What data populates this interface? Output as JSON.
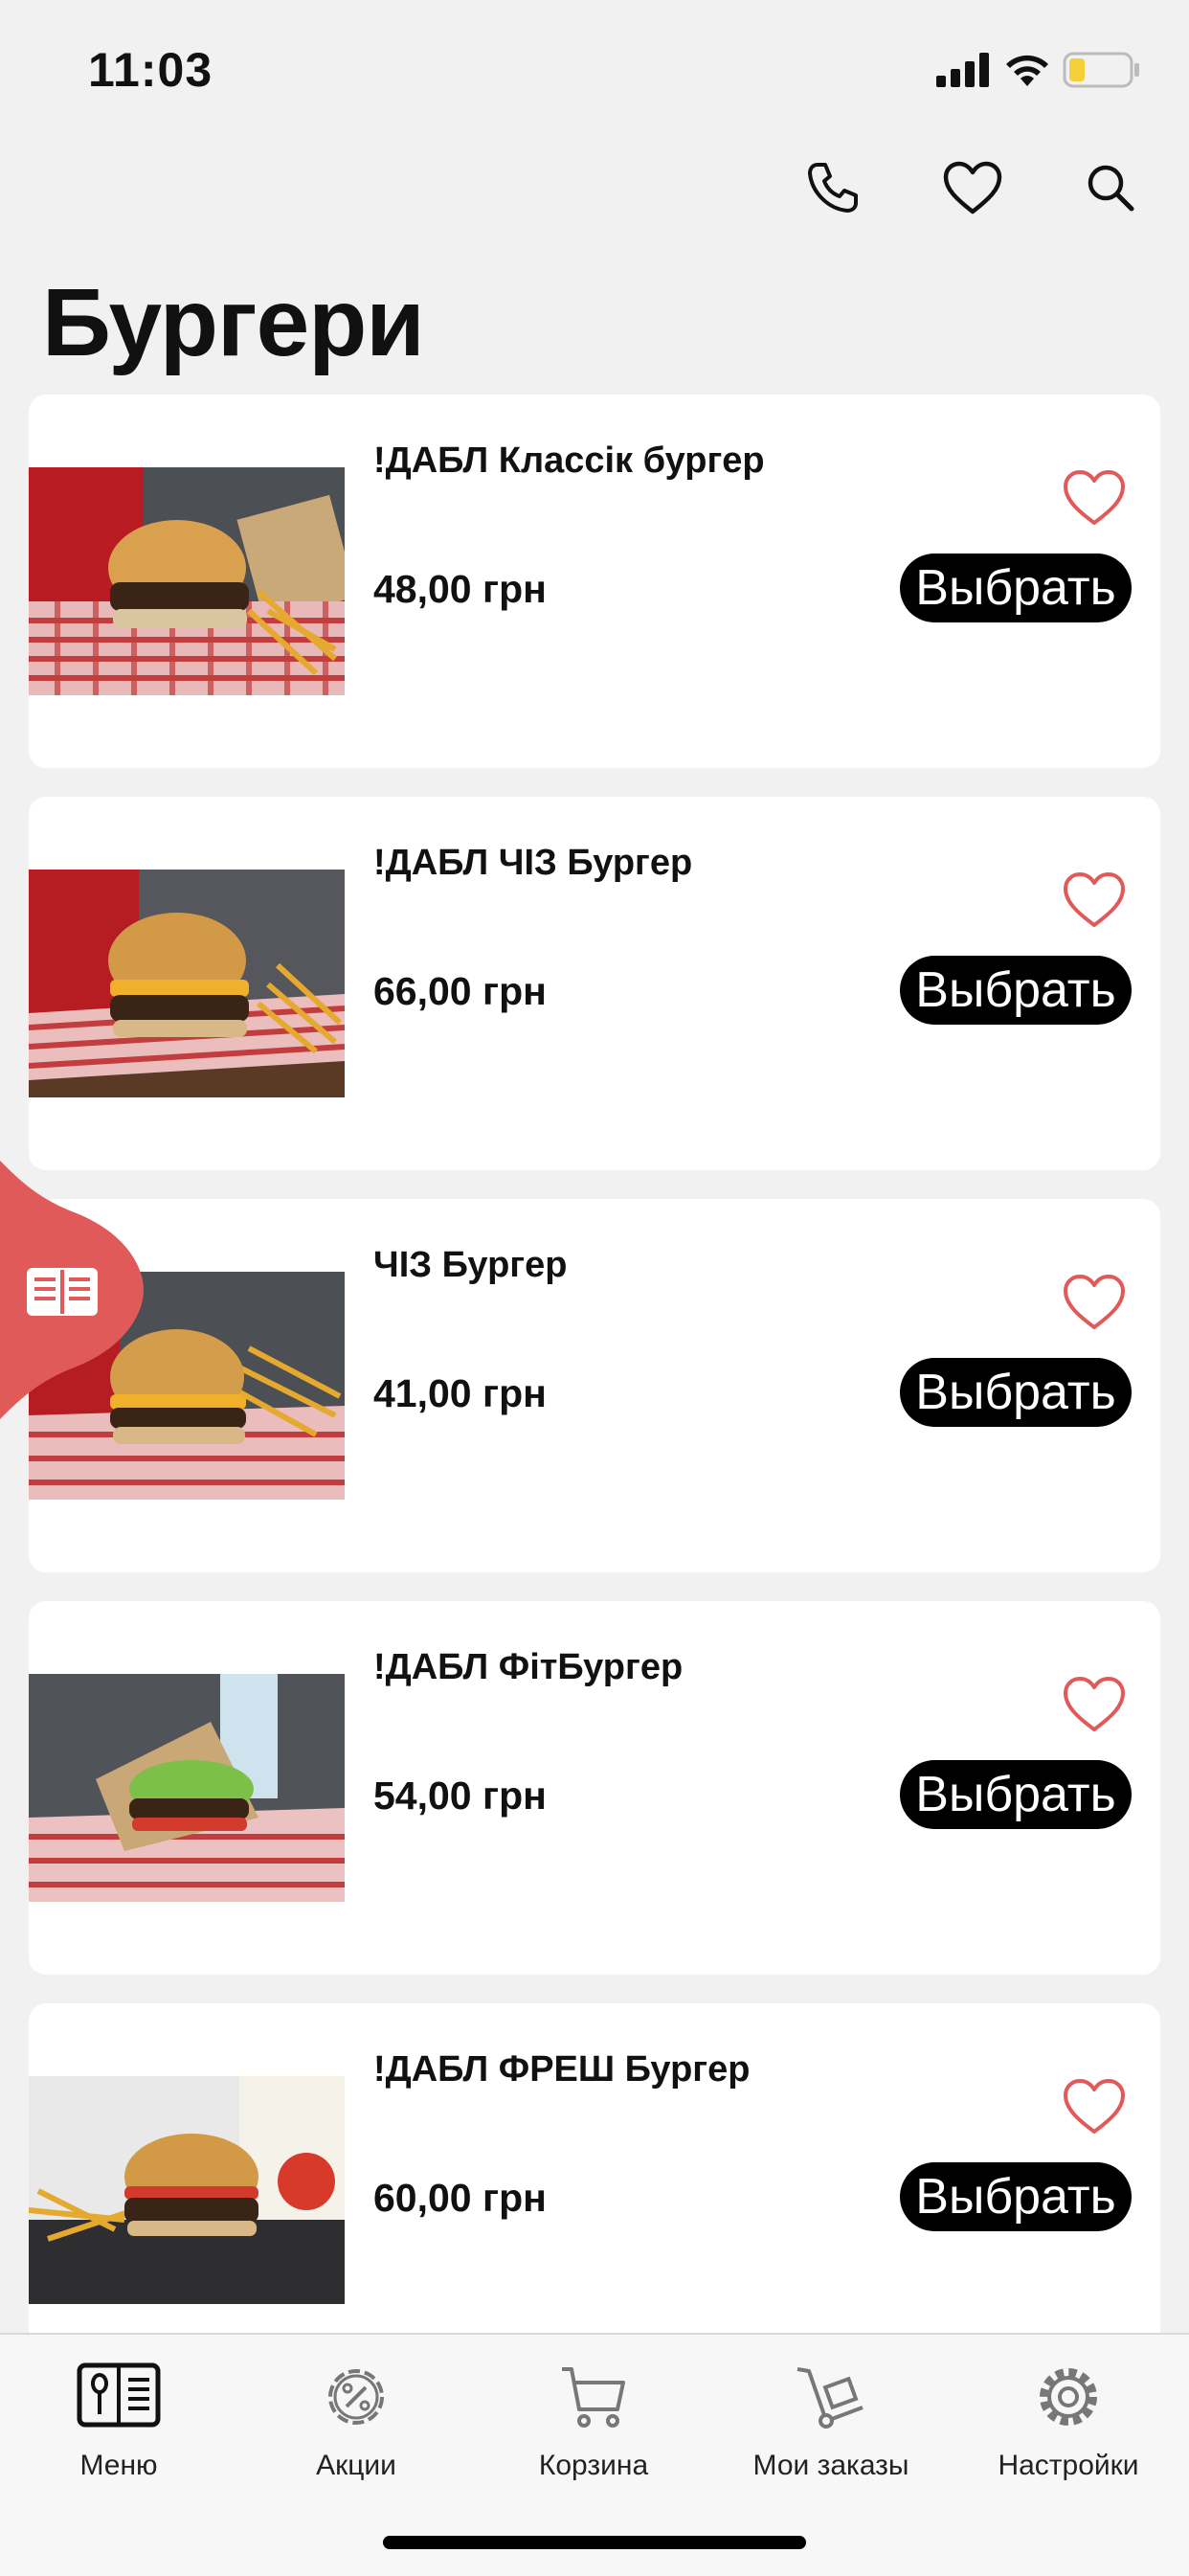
{
  "status_bar": {
    "time": "11:03"
  },
  "header": {
    "title": "Бургери"
  },
  "products": [
    {
      "name": "!ДАБЛ Классік бургер",
      "price": "48,00 грн",
      "button_label": "Выбрать"
    },
    {
      "name": "!ДАБЛ ЧІЗ Бургер",
      "price": "66,00 грн",
      "button_label": "Выбрать"
    },
    {
      "name": "ЧІЗ Бургер",
      "price": "41,00 грн",
      "button_label": "Выбрать"
    },
    {
      "name": "!ДАБЛ ФітБургер",
      "price": "54,00 грн",
      "button_label": "Выбрать"
    },
    {
      "name": "!ДАБЛ ФРЕШ Бургер",
      "price": "60,00 грн",
      "button_label": "Выбрать"
    }
  ],
  "bottom_nav": [
    {
      "label": "Меню",
      "icon": "menu-book-icon",
      "active": true
    },
    {
      "label": "Акции",
      "icon": "discount-gear-icon"
    },
    {
      "label": "Корзина",
      "icon": "cart-icon"
    },
    {
      "label": "Мои заказы",
      "icon": "hand-truck-icon"
    },
    {
      "label": "Настройки",
      "icon": "gear-icon"
    }
  ],
  "colors": {
    "accent": "#e05a5a",
    "button": "#000000",
    "card": "#ffffff",
    "background": "#f1f1f1"
  }
}
